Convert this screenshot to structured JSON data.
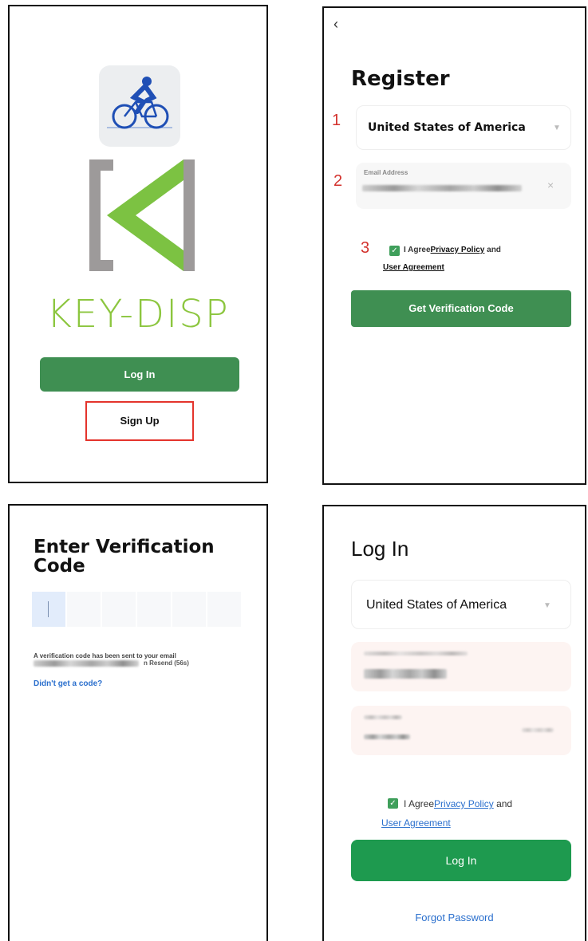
{
  "panel1": {
    "brand_text": "KEY-DISP",
    "login_label": "Log In",
    "signup_label": "Sign Up",
    "colors": {
      "brand": "#8cc63f",
      "button": "#3f8f52",
      "highlight": "#e4342c"
    }
  },
  "panel2": {
    "back_icon": "‹",
    "title": "Register",
    "step1": "1",
    "step2": "2",
    "step3": "3",
    "country_value": "United States of America",
    "email_label": "Email Address",
    "agree_prefix": "I Agree",
    "privacy_link": "Privacy Policy",
    "and_text": "and",
    "user_agreement_link": "User Agreement",
    "verify_button": "Get Verification Code"
  },
  "panel3": {
    "title": "Enter Verification Code",
    "sent_text": "A verification code has been sent to your email",
    "resend_text": "n Resend (56s)",
    "didnt_get": "Didn't get a code?"
  },
  "panel4": {
    "title": "Log In",
    "country_value": "United States of America",
    "agree_prefix": "I Agree",
    "privacy_link": "Privacy Policy",
    "and_text": "and",
    "user_agreement_link": "User Agreement",
    "login_button": "Log In",
    "forgot_link": "Forgot Password",
    "colors": {
      "button": "#1e9a4f",
      "link": "#2a6fcd"
    }
  }
}
